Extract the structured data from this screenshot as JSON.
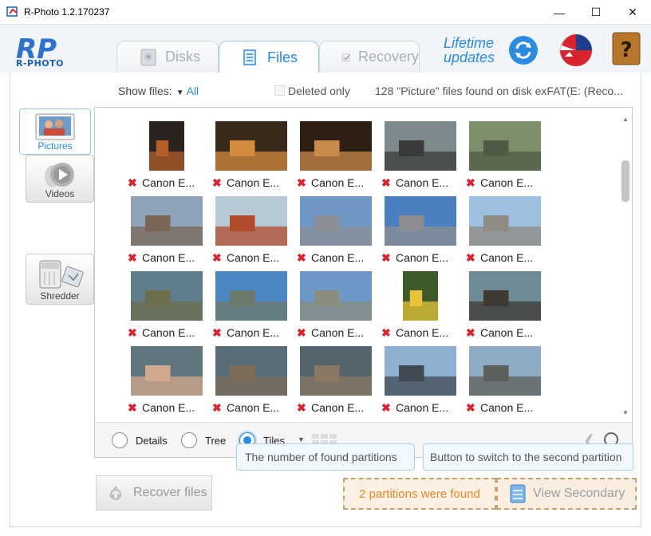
{
  "window": {
    "title": "R-Photo 1.2.170237",
    "minimize": "—",
    "maximize": "☐",
    "close": "✕"
  },
  "header": {
    "logo_text": "R-PHOTO",
    "tabs": [
      {
        "label": "Disks",
        "icon": "disk-icon",
        "active": false
      },
      {
        "label": "Files",
        "icon": "files-icon",
        "active": true
      },
      {
        "label": "Recovery",
        "icon": "recovery-icon",
        "active": false
      }
    ],
    "lifetime_line1": "Lifetime",
    "lifetime_line2": "updates",
    "accent_color": "#2b8be0"
  },
  "filter": {
    "show_files_label": "Show files:",
    "show_files_value": "All",
    "deleted_only_label": "Deleted only",
    "deleted_only_checked": false,
    "found_text": "128 \"Picture\" files found on disk exFAT(E: (Reco..."
  },
  "sidebar": {
    "items": [
      {
        "label": "Pictures",
        "icon": "pictures-icon",
        "active": true
      },
      {
        "label": "Videos",
        "icon": "videos-icon",
        "active": false
      },
      {
        "label": "Shredder",
        "icon": "shredder-icon",
        "active": false
      }
    ]
  },
  "grid": {
    "deleted_mark": "✖",
    "tiles": [
      {
        "label": "Canon E...",
        "bg": "#2c2320",
        "fg": "#b35f2a",
        "portrait": true
      },
      {
        "label": "Canon E...",
        "bg": "#3a2a1c",
        "fg": "#d18a3e",
        "portrait": false
      },
      {
        "label": "Canon E...",
        "bg": "#2d1f14",
        "fg": "#c98a4b",
        "portrait": false
      },
      {
        "label": "Canon E...",
        "bg": "#7c8a8e",
        "fg": "#3b3b3b",
        "portrait": false
      },
      {
        "label": "Canon E...",
        "bg": "#7d8f6a",
        "fg": "#4f5b44",
        "portrait": false
      },
      {
        "label": "Canon E...",
        "bg": "#8ea3b9",
        "fg": "#7a6757",
        "portrait": false
      },
      {
        "label": "Canon E...",
        "bg": "#b8c9d6",
        "fg": "#b24a2c",
        "portrait": false
      },
      {
        "label": "Canon E...",
        "bg": "#6e97c6",
        "fg": "#8a8f96",
        "portrait": false
      },
      {
        "label": "Canon E...",
        "bg": "#4c7fc0",
        "fg": "#8b8d90",
        "portrait": false
      },
      {
        "label": "Canon E...",
        "bg": "#9dbfe0",
        "fg": "#8f8a83",
        "portrait": false
      },
      {
        "label": "Canon E...",
        "bg": "#5f7d8a",
        "fg": "#6d6e4e",
        "portrait": false
      },
      {
        "label": "Canon E...",
        "bg": "#4c86c4",
        "fg": "#6b7a6c",
        "portrait": false
      },
      {
        "label": "Canon E...",
        "bg": "#6c98c8",
        "fg": "#8a8c80",
        "portrait": false
      },
      {
        "label": "Canon E...",
        "bg": "#3e5a2a",
        "fg": "#e6c33a",
        "portrait": true
      },
      {
        "label": "Canon E...",
        "bg": "#6d8a96",
        "fg": "#3e3a34",
        "portrait": false
      },
      {
        "label": "Canon E...",
        "bg": "#61757e",
        "fg": "#d1a98c",
        "portrait": false
      },
      {
        "label": "Canon E...",
        "bg": "#5a6e7a",
        "fg": "#7d6c58",
        "portrait": false
      },
      {
        "label": "Canon E...",
        "bg": "#55656e",
        "fg": "#8a7864",
        "portrait": false
      },
      {
        "label": "Canon E...",
        "bg": "#8fb0d0",
        "fg": "#3f4a52",
        "portrait": false
      },
      {
        "label": "Canon E...",
        "bg": "#8eaac4",
        "fg": "#5d5f5b",
        "portrait": false
      }
    ]
  },
  "viewbar": {
    "details_label": "Details",
    "tree_label": "Tree",
    "tiles_label": "Tiles",
    "selected": "Tiles"
  },
  "bottom": {
    "recover_label": "Recover files",
    "tip_partitions": "The number of found partitions",
    "tip_switch": "Button to switch to the second partition",
    "partitions_found": "2 partitions were found",
    "view_secondary": "View Secondary"
  }
}
